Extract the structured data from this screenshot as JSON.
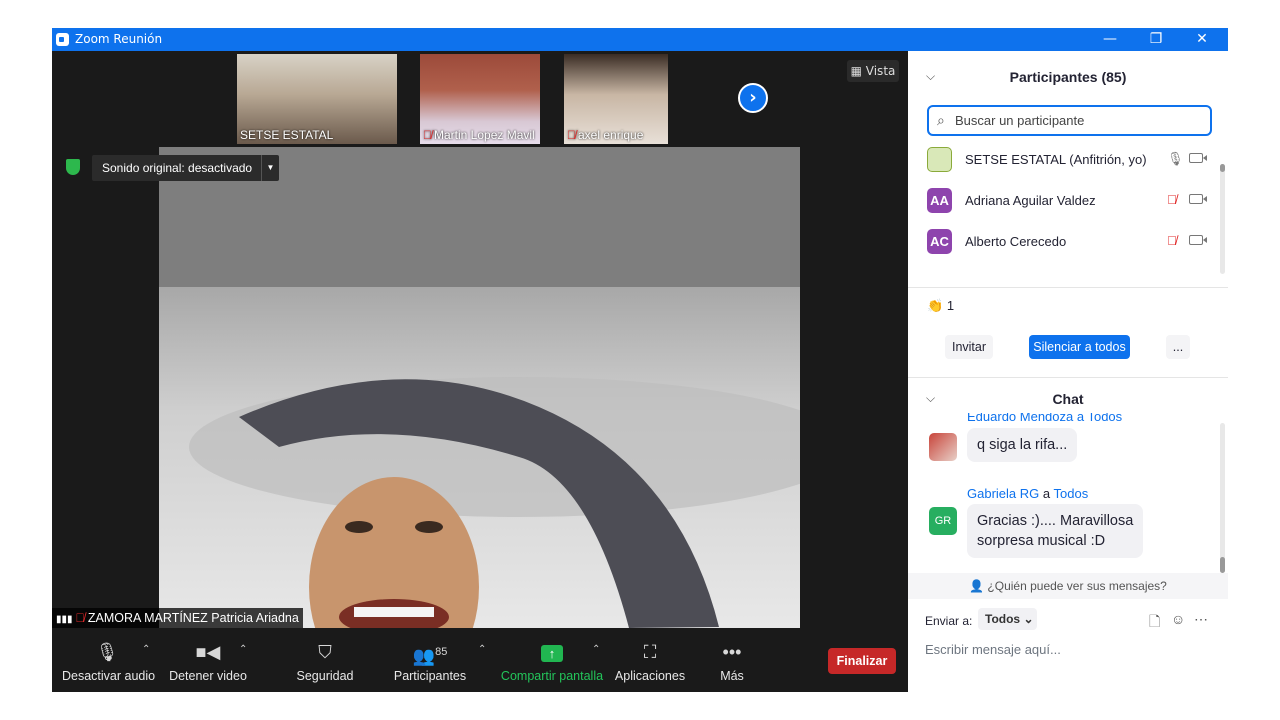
{
  "window": {
    "title": "Zoom Reunión",
    "minimize_icon": "—",
    "restore_icon": "❐",
    "close_icon": "✕"
  },
  "gallery": {
    "thumbs": [
      {
        "name": "SETSE ESTATAL",
        "muted": false
      },
      {
        "name": "Martin Lopez Mavil",
        "muted": true
      },
      {
        "name": "axel enrique",
        "muted": true
      }
    ],
    "next_icon": "›",
    "view_label": "Vista"
  },
  "main_video": {
    "sound_label": "Sonido original: desactivado",
    "speaker_name": "ZAMORA MARTÍNEZ Patricia Ariadna"
  },
  "toolbar": {
    "audio_label": "Desactivar audio",
    "video_label": "Detener video",
    "security_label": "Seguridad",
    "participants_label": "Participantes",
    "participants_count": "85",
    "share_label": "Compartir pantalla",
    "apps_label": "Aplicaciones",
    "more_label": "Más",
    "end_label": "Finalizar"
  },
  "participants_panel": {
    "title": "Participantes (85)",
    "search_placeholder": "Buscar un participante",
    "items": [
      {
        "initials": "",
        "name": "SETSE ESTATAL (Anfitrión, yo)",
        "mic_muted": false
      },
      {
        "initials": "AA",
        "name": "Adriana Aguilar Valdez",
        "mic_muted": true
      },
      {
        "initials": "AC",
        "name": "Alberto Cerecedo",
        "mic_muted": true
      }
    ],
    "reaction_count": "1",
    "invite_label": "Invitar",
    "mute_all_label": "Silenciar a todos",
    "more_label": "..."
  },
  "chat": {
    "title": "Chat",
    "partial_sender": "Eduardo Mendoza a Todos",
    "messages": [
      {
        "sender": "",
        "to": "",
        "text": "q siga la rifa..."
      },
      {
        "sender": "Gabriela RG",
        "connector": "a",
        "to": "Todos",
        "initials": "GR",
        "text_line1": "Gracias :).... Maravillosa",
        "text_line2": "sorpresa musical :D"
      }
    ],
    "who_sees": "¿Quién puede ver sus mensajes?",
    "send_to_label": "Enviar a:",
    "send_to_value": "Todos",
    "input_placeholder": "Escribir mensaje aquí..."
  },
  "colors": {
    "accent": "#0e72ed",
    "share_green": "#21b651",
    "end_red": "#c62828",
    "avatar_purple": "#8e44ad",
    "muted_red": "#e02828"
  }
}
